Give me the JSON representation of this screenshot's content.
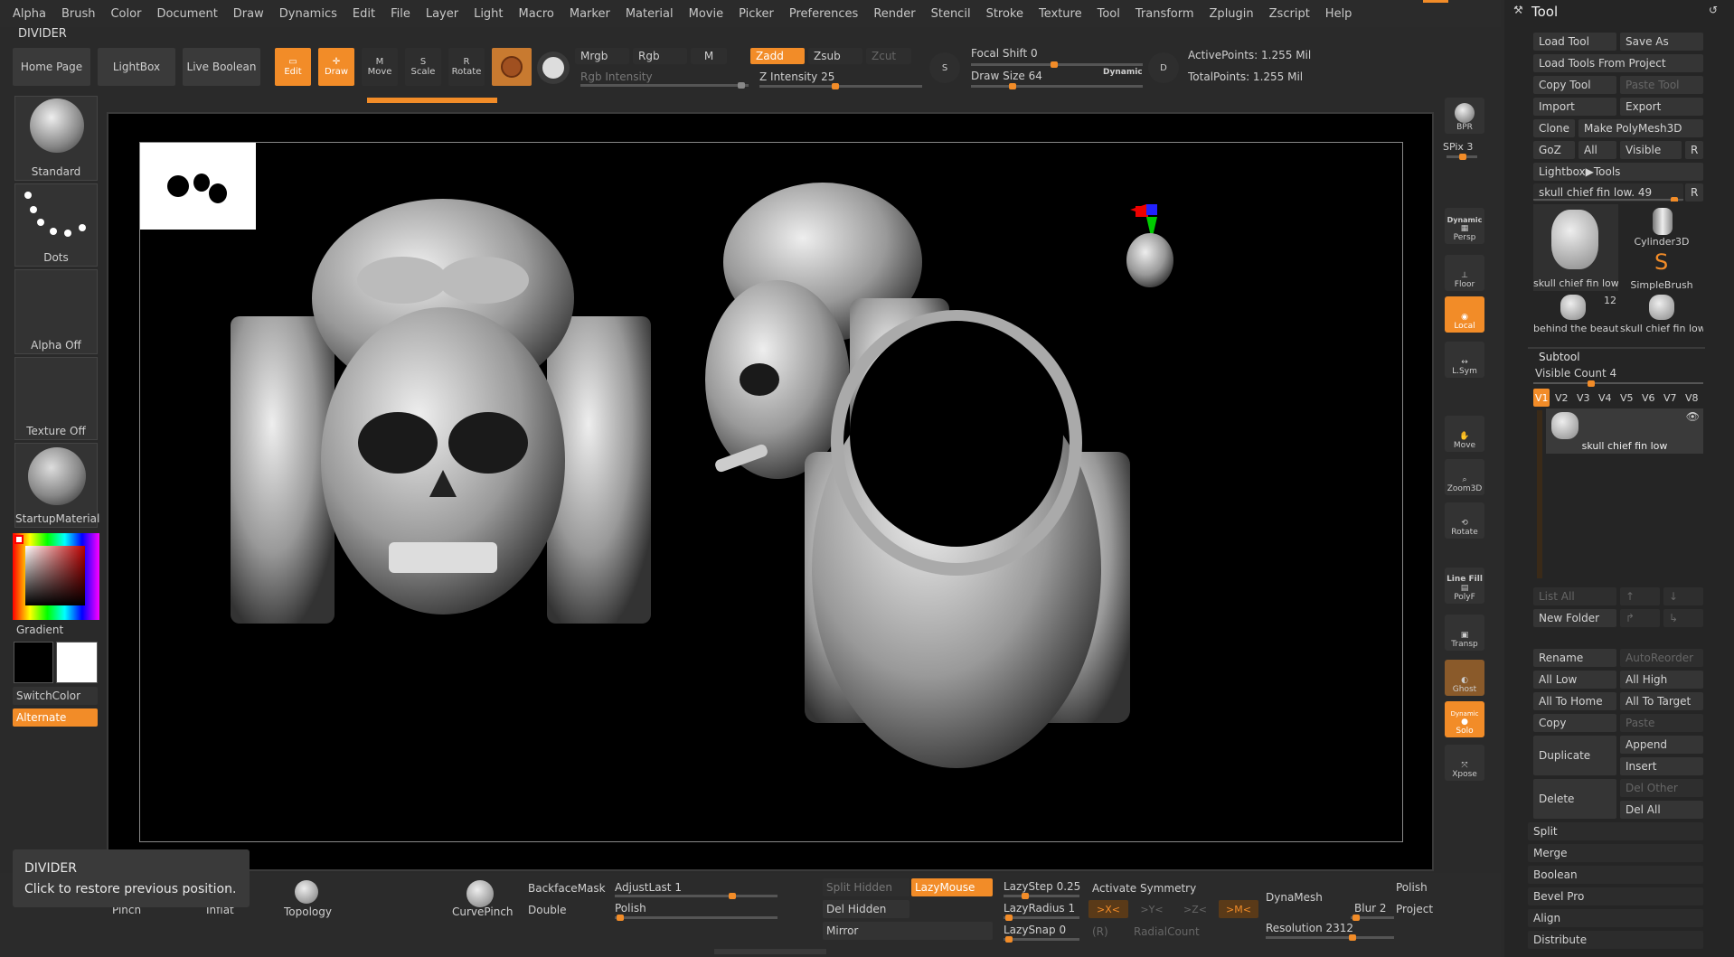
{
  "menu": [
    "Alpha",
    "Brush",
    "Color",
    "Document",
    "Draw",
    "Dynamics",
    "Edit",
    "File",
    "Layer",
    "Light",
    "Macro",
    "Marker",
    "Material",
    "Movie",
    "Picker",
    "Preferences",
    "Render",
    "Stencil",
    "Stroke",
    "Texture",
    "Tool",
    "Transform",
    "Zplugin",
    "Zscript",
    "Help"
  ],
  "divider_label": "DIVIDER",
  "toolbar": {
    "home": "Home Page",
    "lightbox": "LightBox",
    "liveboolean": "Live Boolean",
    "edit": "Edit",
    "draw": "Draw",
    "move": "Move",
    "scale": "Scale",
    "rotate": "Rotate",
    "mrgb": "Mrgb",
    "rgb": "Rgb",
    "m": "M",
    "rgb_intensity": "Rgb Intensity",
    "zadd": "Zadd",
    "zsub": "Zsub",
    "zcut": "Zcut",
    "z_intensity": "Z Intensity 25",
    "focal_shift": "Focal Shift 0",
    "draw_size": "Draw Size 64",
    "dynamic": "Dynamic",
    "active_points": "ActivePoints: 1.255 Mil",
    "total_points": "TotalPoints: 1.255 Mil",
    "s": "S",
    "d": "D"
  },
  "left_tray": {
    "brush": "Standard",
    "stroke": "Dots",
    "alpha": "Alpha Off",
    "texture": "Texture Off",
    "material": "StartupMaterial",
    "gradient": "Gradient",
    "switchcolor": "SwitchColor",
    "alternate": "Alternate"
  },
  "right_tools": {
    "bpr": "BPR",
    "spix": "SPix 3",
    "persp_top": "Dynamic",
    "persp": "Persp",
    "floor": "Floor",
    "local": "Local",
    "lsym": "L.Sym",
    "move": "Move",
    "zoom3d": "Zoom3D",
    "rotate": "Rotate",
    "linefill": "Line Fill",
    "polyf": "PolyF",
    "transp": "Transp",
    "ghost": "Ghost",
    "solo_top": "Dynamic",
    "solo": "Solo",
    "xpose": "Xpose"
  },
  "tool_panel": {
    "title": "Tool",
    "load_tool": "Load Tool",
    "save_as": "Save As",
    "load_from_project": "Load Tools From Project",
    "copy_tool": "Copy Tool",
    "paste_tool": "Paste Tool",
    "import": "Import",
    "export": "Export",
    "clone": "Clone",
    "make_polymesh": "Make PolyMesh3D",
    "goz": "GoZ",
    "all": "All",
    "visible": "Visible",
    "r": "R",
    "lightbox_tools": "Lightbox▶Tools",
    "current_tool": "skull chief fin low. 49",
    "thumbs": [
      "skull chief fin low",
      "Cylinder3D",
      "SimpleBrush",
      "behind the beaut",
      "skull chief fin low"
    ],
    "thumb_count": "12",
    "subtool": "Subtool",
    "visible_count": "Visible Count 4",
    "vtabs": [
      "V1",
      "V2",
      "V3",
      "V4",
      "V5",
      "V6",
      "V7",
      "V8"
    ],
    "subtool_item": "skull chief fin low",
    "list_all": "List All",
    "new_folder": "New Folder",
    "rename": "Rename",
    "autoreorder": "AutoReorder",
    "all_low": "All Low",
    "all_high": "All High",
    "all_to_home": "All To Home",
    "all_to_target": "All To Target",
    "copy": "Copy",
    "paste": "Paste",
    "duplicate": "Duplicate",
    "append": "Append",
    "insert": "Insert",
    "delete": "Delete",
    "del_other": "Del Other",
    "del_all": "Del All",
    "split": "Split",
    "merge": "Merge",
    "boolean": "Boolean",
    "bevel_pro": "Bevel Pro",
    "align": "Align",
    "distribute": "Distribute"
  },
  "bottom": {
    "pinch": "Pinch",
    "inflat": "Inflat",
    "topology": "Topology",
    "curvepinch": "CurvePinch",
    "backfacemask": "BackfaceMask",
    "double": "Double",
    "adjustlast": "AdjustLast 1",
    "polish": "Polish",
    "split_hidden": "Split Hidden",
    "del_hidden": "Del Hidden",
    "mirror": "Mirror",
    "lazymouse": "LazyMouse",
    "lazystep": "LazyStep 0.25",
    "lazyradius": "LazyRadius 1",
    "lazysnap": "LazySnap 0",
    "activate_symmetry": "Activate Symmetry",
    "x": ">X<",
    "y": ">Y<",
    "z": ">Z<",
    "m": ">M<",
    "r": "(R)",
    "radialcount": "RadialCount",
    "dynamesh": "DynaMesh",
    "blur": "Blur 2",
    "resolution": "Resolution 2312",
    "polish2": "Polish",
    "project": "Project"
  },
  "tooltip": {
    "title": "DIVIDER",
    "text": "Click to restore previous position."
  },
  "colors": {
    "accent": "#f28c28",
    "bg": "#2a2a2a",
    "canvas": "#000000"
  }
}
